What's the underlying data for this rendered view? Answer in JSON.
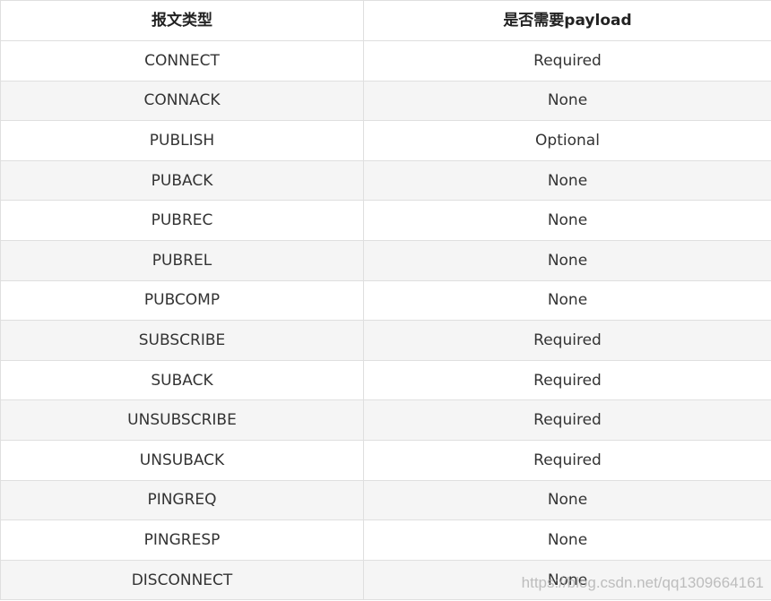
{
  "table": {
    "headers": [
      "报文类型",
      "是否需要payload"
    ],
    "rows": [
      [
        "CONNECT",
        "Required"
      ],
      [
        "CONNACK",
        "None"
      ],
      [
        "PUBLISH",
        "Optional"
      ],
      [
        "PUBACK",
        "None"
      ],
      [
        "PUBREC",
        "None"
      ],
      [
        "PUBREL",
        "None"
      ],
      [
        "PUBCOMP",
        "None"
      ],
      [
        "SUBSCRIBE",
        "Required"
      ],
      [
        "SUBACK",
        "Required"
      ],
      [
        "UNSUBSCRIBE",
        "Required"
      ],
      [
        "UNSUBACK",
        "Required"
      ],
      [
        "PINGREQ",
        "None"
      ],
      [
        "PINGRESP",
        "None"
      ],
      [
        "DISCONNECT",
        "None"
      ]
    ]
  },
  "watermark": "https://blog.csdn.net/qq1309664161",
  "colors": {
    "border": "#dfdfdf",
    "stripe": "#f5f5f5",
    "text": "#333333",
    "watermark": "#aaaaaa"
  }
}
